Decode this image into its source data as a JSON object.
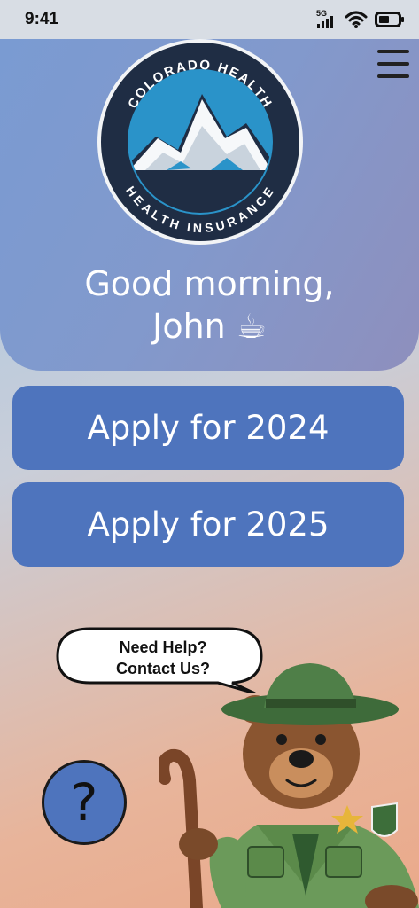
{
  "status_bar": {
    "time": "9:41",
    "network": "5G",
    "icons": [
      "signal-icon",
      "wifi-icon",
      "battery-icon"
    ]
  },
  "header": {
    "logo": {
      "top_text": "COLORADO HEALTH",
      "bottom_text": "HEALTH INSURANCE"
    },
    "greeting_line1": "Good morning,",
    "greeting_line2": "John ☕",
    "menu_icon": "hamburger-menu-icon"
  },
  "actions": {
    "apply_2024": "Apply for 2024",
    "apply_2025": "Apply for 2025"
  },
  "help": {
    "bubble_line1": "Need Help?",
    "bubble_line2": "Contact Us?",
    "button_label": "?"
  },
  "colors": {
    "button": "#4e74bd",
    "header": "#8299cc",
    "logo_navy": "#1f2d44",
    "logo_sky": "#2a93c9"
  }
}
